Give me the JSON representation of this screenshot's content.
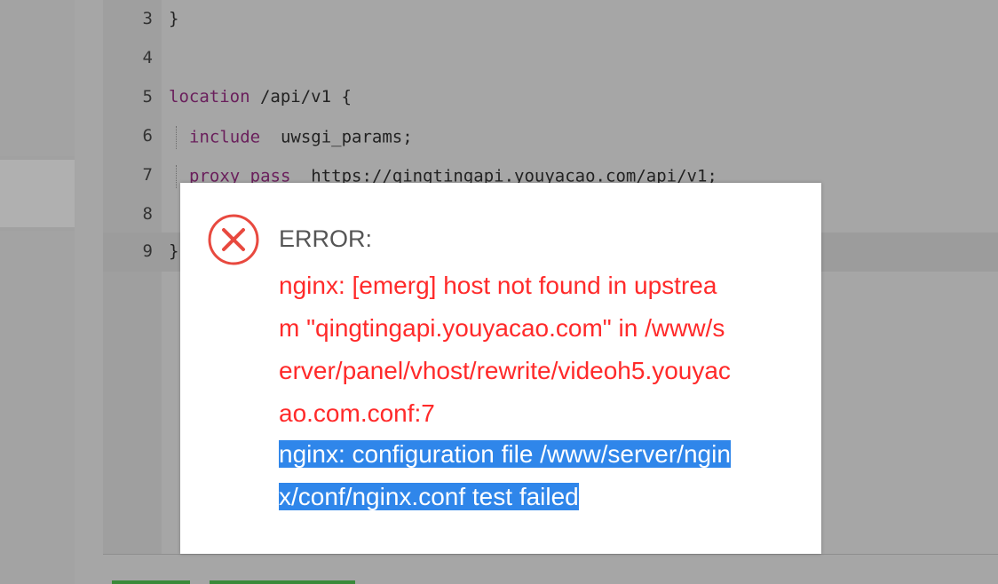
{
  "editor": {
    "lines": [
      {
        "num": "3",
        "text": "}"
      },
      {
        "num": "4",
        "text": ""
      },
      {
        "num": "5",
        "keyword": "location",
        "text": " /api/v1 {"
      },
      {
        "num": "6",
        "keyword": "include",
        "text": "  uwsgi_params;"
      },
      {
        "num": "7",
        "keyword": "proxy_pass",
        "text": "  https://qingtingapi.youyacao.com/api/v1;"
      },
      {
        "num": "8",
        "text": ""
      },
      {
        "num": "9",
        "text": "}"
      }
    ]
  },
  "dialog": {
    "title": "ERROR:",
    "message_lines": [
      "nginx: [emerg] host not found in upstrea",
      "m \"qingtingapi.youyacao.com\" in /www/s",
      "erver/panel/vhost/rewrite/videoh5.youyac",
      "ao.com.conf:7"
    ],
    "selected_lines": [
      "nginx: configuration file /www/server/ngin",
      "x/conf/nginx.conf test failed"
    ],
    "icon": "error-circle-x-icon",
    "colors": {
      "error_text": "#ff2a2a",
      "icon": "#e8493f",
      "selection": "#2f86ea"
    }
  }
}
